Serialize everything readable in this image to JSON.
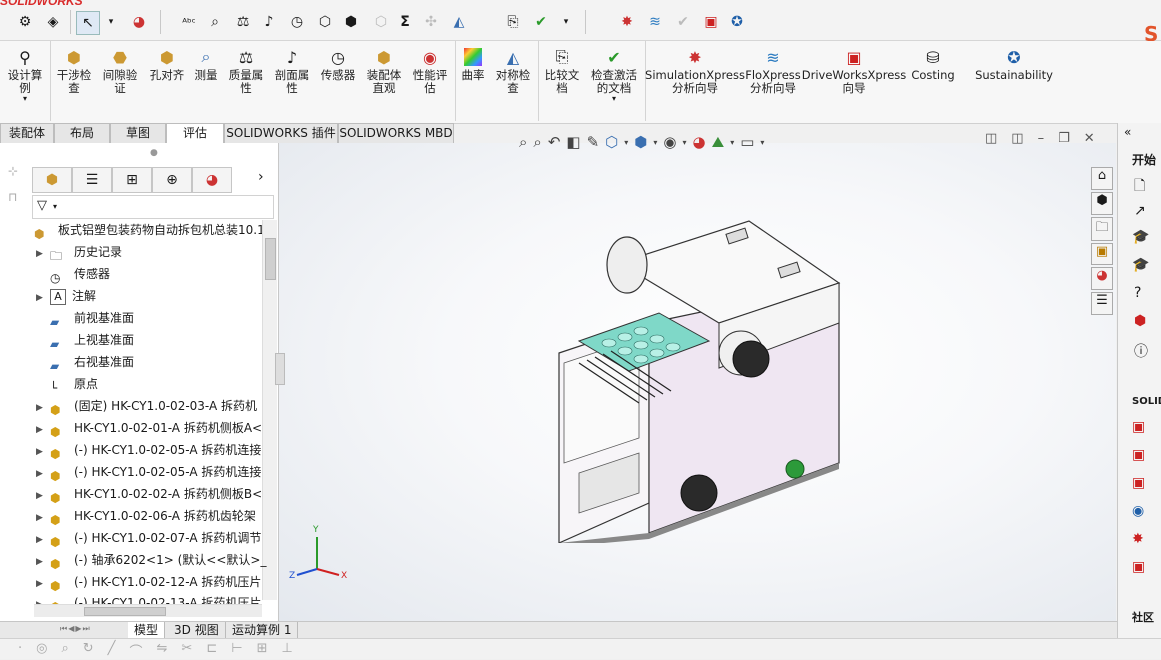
{
  "app": {
    "logo_text": "SOLIDWORKS"
  },
  "ribbon": {
    "buttons": [
      {
        "label": "设计算\n例",
        "icon": "design-study-icon"
      },
      {
        "label": "干涉检\n查",
        "icon": "interference-icon"
      },
      {
        "label": "间隙验\n证",
        "icon": "clearance-icon"
      },
      {
        "label": "孔对齐",
        "icon": "hole-align-icon"
      },
      {
        "label": "测量",
        "icon": "measure-icon"
      },
      {
        "label": "质量属\n性",
        "icon": "mass-props-icon"
      },
      {
        "label": "剖面属\n性",
        "icon": "section-props-icon"
      },
      {
        "label": "传感器",
        "icon": "sensor-icon"
      },
      {
        "label": "装配体\n直观",
        "icon": "assembly-visual-icon"
      },
      {
        "label": "性能评\n估",
        "icon": "performance-icon"
      },
      {
        "label": "曲率",
        "icon": "curvature-icon"
      },
      {
        "label": "对称检\n查",
        "icon": "symmetry-icon"
      },
      {
        "label": "比较文\n档",
        "icon": "compare-icon"
      },
      {
        "label": "检查激活\n的文档",
        "icon": "check-doc-icon"
      },
      {
        "label": "SimulationXpress\n分析向导",
        "icon": "simxpress-icon"
      },
      {
        "label": "FloXpress\n分析向导",
        "icon": "floxpress-icon"
      },
      {
        "label": "DriveWorksXpress\n向导",
        "icon": "driveworks-icon"
      },
      {
        "label": "Costing",
        "icon": "costing-icon"
      },
      {
        "label": "Sustainability",
        "icon": "sustainability-icon"
      }
    ]
  },
  "tabs": [
    {
      "label": "装配体"
    },
    {
      "label": "布局"
    },
    {
      "label": "草图"
    },
    {
      "label": "评估"
    },
    {
      "label": "SOLIDWORKS 插件"
    },
    {
      "label": "SOLIDWORKS MBD"
    }
  ],
  "tree": {
    "root": "板式铝塑包装药物自动拆包机总装10.1",
    "items": [
      {
        "label": "历史记录",
        "arrow": "▶"
      },
      {
        "label": "传感器",
        "arrow": ""
      },
      {
        "label": "注解",
        "arrow": "▶"
      },
      {
        "label": "前视基准面",
        "arrow": ""
      },
      {
        "label": "上视基准面",
        "arrow": ""
      },
      {
        "label": "右视基准面",
        "arrow": ""
      },
      {
        "label": "原点",
        "arrow": ""
      },
      {
        "label": "(固定) HK-CY1.0-02-03-A 拆药机",
        "arrow": "▶"
      },
      {
        "label": "HK-CY1.0-02-01-A 拆药机侧板A<",
        "arrow": "▶"
      },
      {
        "label": "(-) HK-CY1.0-02-05-A 拆药机连接",
        "arrow": "▶"
      },
      {
        "label": "(-) HK-CY1.0-02-05-A 拆药机连接",
        "arrow": "▶"
      },
      {
        "label": "HK-CY1.0-02-02-A 拆药机侧板B<",
        "arrow": "▶"
      },
      {
        "label": "HK-CY1.0-02-06-A 拆药机齿轮架",
        "arrow": "▶"
      },
      {
        "label": "(-) HK-CY1.0-02-07-A 拆药机调节",
        "arrow": "▶"
      },
      {
        "label": "(-) 轴承6202<1> (默认<<默认>_",
        "arrow": "▶"
      },
      {
        "label": "(-) HK-CY1.0-02-12-A 拆药机压片",
        "arrow": "▶"
      },
      {
        "label": "(-) HK-CY1.0-02-13-A 拆药机压片",
        "arrow": "▶"
      }
    ]
  },
  "bottom_tabs": [
    {
      "label": "模型"
    },
    {
      "label": "3D 视图"
    },
    {
      "label": "运动算例 1"
    }
  ],
  "task_pane": {
    "heading": "开始",
    "section": "SOLID",
    "bottom_label": "社区"
  },
  "triad": {
    "x": "X",
    "y": "Y",
    "z": "Z"
  },
  "colors": {
    "accent": "#1f5fa8",
    "brand_red": "#d92b2b",
    "machine_panel": "#efe6f2"
  }
}
